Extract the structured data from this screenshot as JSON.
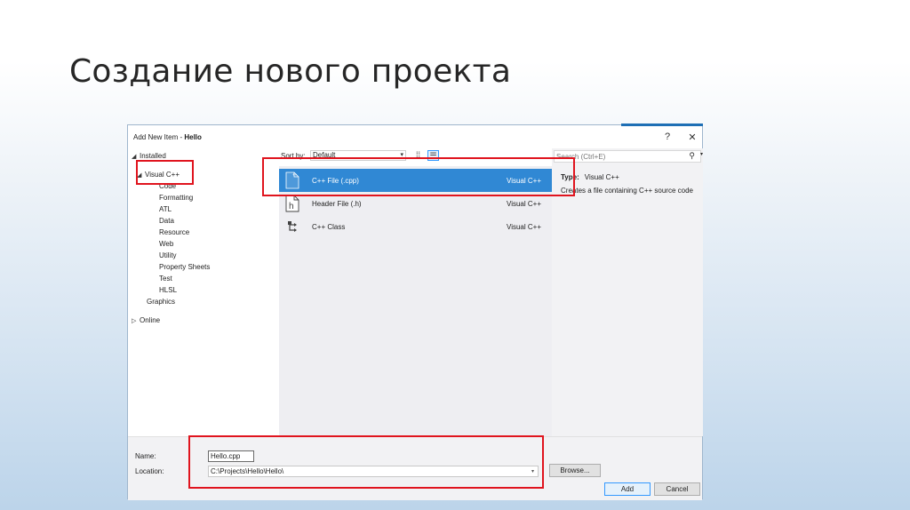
{
  "slide": {
    "title": "Создание нового проекта"
  },
  "dialog": {
    "title_prefix": "Add New Item - ",
    "title_project": "Hello",
    "help_label": "?",
    "close_label": "✕",
    "tree": {
      "installed": "Installed",
      "visual_cpp": "Visual C++",
      "children": [
        "Code",
        "Formatting",
        "ATL",
        "Data",
        "Resource",
        "Web",
        "Utility",
        "Property Sheets",
        "Test",
        "HLSL"
      ],
      "graphics": "Graphics",
      "online": "Online"
    },
    "sort_label": "Sort by:",
    "sort_value": "Default",
    "items": [
      {
        "name": "C++ File (.cpp)",
        "lang": "Visual C++",
        "selected": true,
        "icon": "cpp-file-icon"
      },
      {
        "name": "Header File (.h)",
        "lang": "Visual C++",
        "selected": false,
        "icon": "header-file-icon"
      },
      {
        "name": "C++ Class",
        "lang": "Visual C++",
        "selected": false,
        "icon": "cpp-class-icon"
      }
    ],
    "search_placeholder": "Search (Ctrl+E)",
    "details": {
      "type_label": "Type:",
      "type_value": "Visual C++",
      "description": "Creates a file containing C++ source code"
    },
    "name_label": "Name:",
    "name_value": "Hello.cpp",
    "location_label": "Location:",
    "location_value": "C:\\Projects\\Hello\\Hello\\",
    "browse_label": "Browse...",
    "add_label": "Add",
    "cancel_label": "Cancel"
  },
  "colors": {
    "selection": "#3088d4",
    "highlight": "#e0141e",
    "accent": "#1e6fb5"
  }
}
